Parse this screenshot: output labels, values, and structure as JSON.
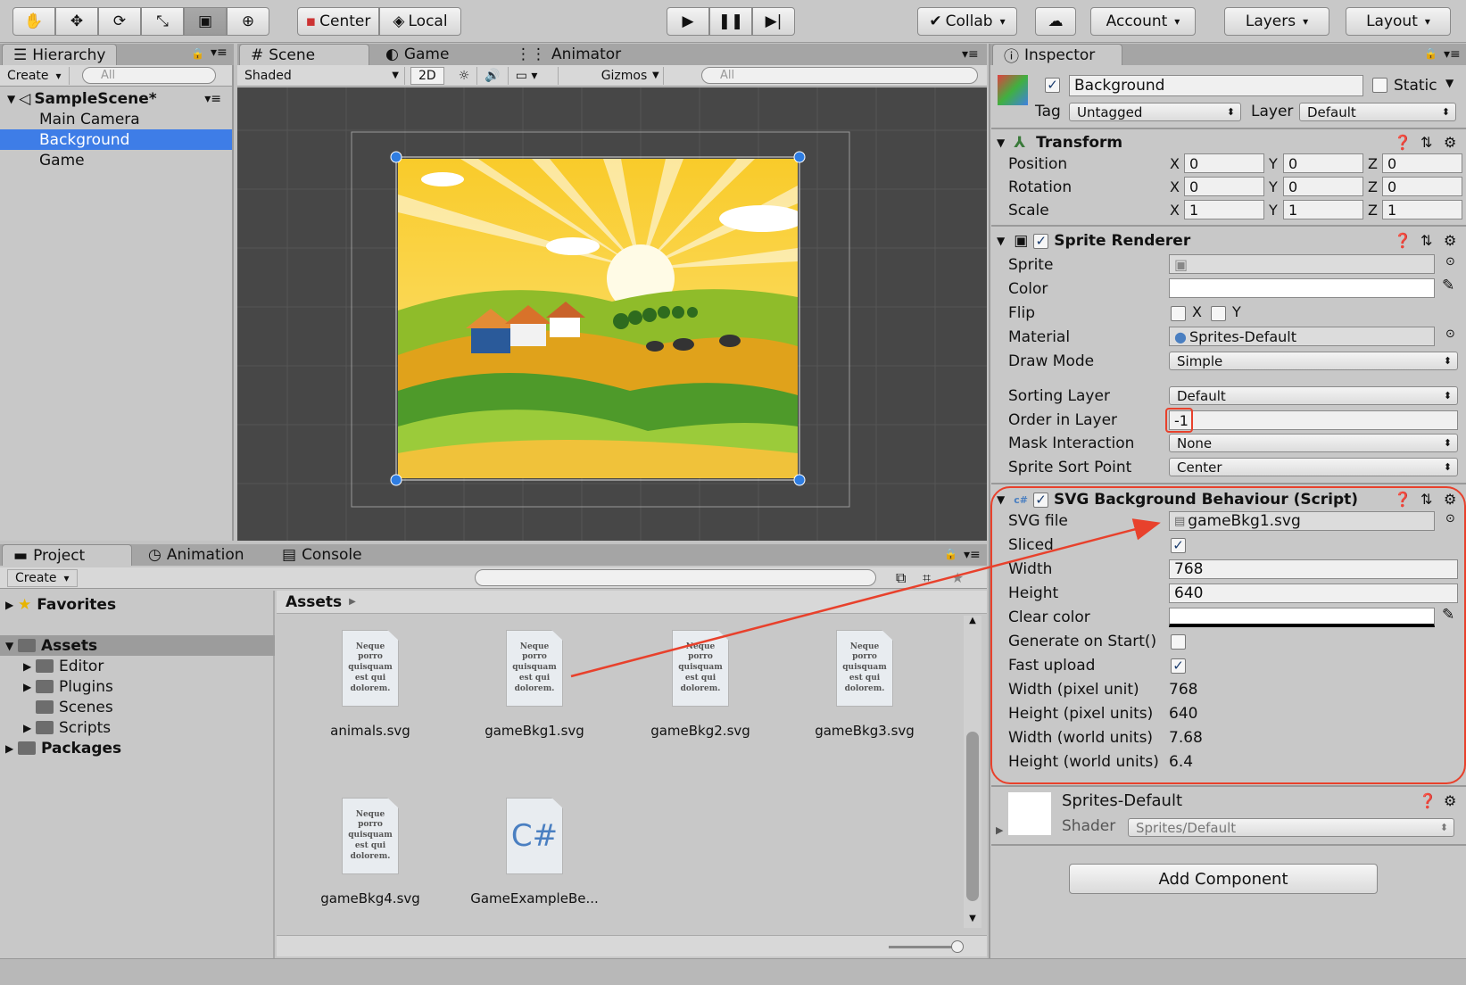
{
  "toolbar": {
    "tools": [
      "hand-tool",
      "move-tool",
      "rotate-tool",
      "scale-tool",
      "rect-tool",
      "transform-tool"
    ],
    "center_label": "Center",
    "local_label": "Local",
    "collab_label": "Collab",
    "account_label": "Account",
    "layers_label": "Layers",
    "layout_label": "Layout"
  },
  "hierarchy": {
    "tab_label": "Hierarchy",
    "create_label": "Create",
    "search_placeholder": "All",
    "scene_name": "SampleScene*",
    "items": [
      {
        "label": "Main Camera",
        "selected": false
      },
      {
        "label": "Background",
        "selected": true
      },
      {
        "label": "Game",
        "selected": false
      }
    ]
  },
  "scene": {
    "tabs": [
      "Scene",
      "Game",
      "Animator"
    ],
    "shading_mode": "Shaded",
    "mode_2d": "2D",
    "gizmos_label": "Gizmos",
    "search_placeholder": "All"
  },
  "project": {
    "tabs": [
      "Project",
      "Animation",
      "Console"
    ],
    "create_label": "Create",
    "favorites_label": "Favorites",
    "tree": [
      {
        "label": "Assets",
        "bold": true,
        "level": 0
      },
      {
        "label": "Editor",
        "bold": false,
        "level": 1
      },
      {
        "label": "Plugins",
        "bold": false,
        "level": 1
      },
      {
        "label": "Scenes",
        "bold": false,
        "level": 1
      },
      {
        "label": "Scripts",
        "bold": false,
        "level": 1
      },
      {
        "label": "Packages",
        "bold": true,
        "level": 0
      }
    ],
    "breadcrumb": "Assets",
    "assets": [
      {
        "label": "animals.svg",
        "kind": "svg"
      },
      {
        "label": "gameBkg1.svg",
        "kind": "svg"
      },
      {
        "label": "gameBkg2.svg",
        "kind": "svg"
      },
      {
        "label": "gameBkg3.svg",
        "kind": "svg"
      },
      {
        "label": "gameBkg4.svg",
        "kind": "svg"
      },
      {
        "label": "GameExampleBe...",
        "kind": "cs"
      }
    ],
    "svg_preview_text": "Neque porro quisquam est qui dolorem."
  },
  "inspector": {
    "tab_label": "Inspector",
    "object_name": "Background",
    "static_label": "Static",
    "tag_label": "Tag",
    "tag_value": "Untagged",
    "layer_label": "Layer",
    "layer_value": "Default",
    "transform": {
      "title": "Transform",
      "rows": [
        {
          "label": "Position",
          "x": "0",
          "y": "0",
          "z": "0"
        },
        {
          "label": "Rotation",
          "x": "0",
          "y": "0",
          "z": "0"
        },
        {
          "label": "Scale",
          "x": "1",
          "y": "1",
          "z": "1"
        }
      ]
    },
    "sprite_renderer": {
      "title": "Sprite Renderer",
      "sprite_label": "Sprite",
      "color_label": "Color",
      "flip_label": "Flip",
      "flip_x": "X",
      "flip_y": "Y",
      "material_label": "Material",
      "material_value": "Sprites-Default",
      "draw_mode_label": "Draw Mode",
      "draw_mode_value": "Simple",
      "sorting_layer_label": "Sorting Layer",
      "sorting_layer_value": "Default",
      "order_label": "Order in Layer",
      "order_value": "-1",
      "mask_label": "Mask Interaction",
      "mask_value": "None",
      "sort_point_label": "Sprite Sort Point",
      "sort_point_value": "Center"
    },
    "svg_script": {
      "title": "SVG Background Behaviour (Script)",
      "svg_file_label": "SVG file",
      "svg_file_value": "gameBkg1.svg",
      "sliced_label": "Sliced",
      "width_label": "Width",
      "width_value": "768",
      "height_label": "Height",
      "height_value": "640",
      "clear_color_label": "Clear color",
      "generate_label": "Generate on Start()",
      "fast_upload_label": "Fast upload",
      "width_px_label": "Width (pixel unit)",
      "width_px_value": "768",
      "height_px_label": "Height (pixel units)",
      "height_px_value": "640",
      "width_world_label": "Width (world units)",
      "width_world_value": "7.68",
      "height_world_label": "Height (world units)",
      "height_world_value": "6.4"
    },
    "material": {
      "name": "Sprites-Default",
      "shader_label": "Shader",
      "shader_value": "Sprites/Default"
    },
    "add_component_label": "Add Component"
  },
  "colors": {
    "selection": "#3e7de7",
    "highlight_red": "#e8412c",
    "scene_bg": "#474747"
  }
}
